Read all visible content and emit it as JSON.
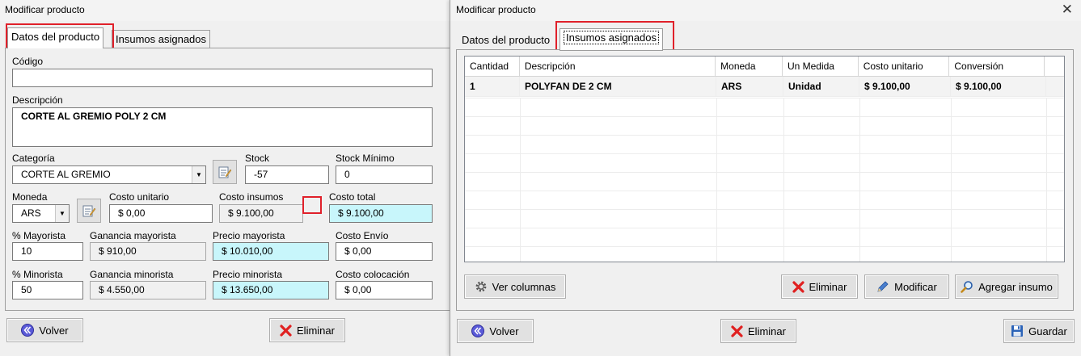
{
  "left": {
    "title": "Modificar producto",
    "tabs": [
      {
        "label": "Datos del producto"
      },
      {
        "label": "Insumos asignados"
      }
    ],
    "fields": {
      "codigo": {
        "label": "Código",
        "value": ""
      },
      "descripcion": {
        "label": "Descripción",
        "value": "CORTE AL GREMIO POLY 2 CM"
      },
      "categoria": {
        "label": "Categoría",
        "value": "CORTE AL GREMIO"
      },
      "stock": {
        "label": "Stock",
        "value": "-57"
      },
      "stock_minimo": {
        "label": "Stock Mínimo",
        "value": "0"
      },
      "moneda": {
        "label": "Moneda",
        "value": "ARS"
      },
      "costo_unitario": {
        "label": "Costo unitario",
        "value": "$ 0,00"
      },
      "costo_insumos": {
        "label": "Costo insumos",
        "value": "$ 9.100,00"
      },
      "costo_total": {
        "label": "Costo total",
        "value": "$ 9.100,00"
      },
      "pct_mayorista": {
        "label": "% Mayorista",
        "value": "10"
      },
      "ganancia_mayorista": {
        "label": "Ganancia mayorista",
        "value": "$ 910,00"
      },
      "precio_mayorista": {
        "label": "Precio mayorista",
        "value": "$ 10.010,00"
      },
      "costo_envio": {
        "label": "Costo Envío",
        "value": "$ 0,00"
      },
      "pct_minorista": {
        "label": "% Minorista",
        "value": "50"
      },
      "ganancia_minorista": {
        "label": "Ganancia minorista",
        "value": "$ 4.550,00"
      },
      "precio_minorista": {
        "label": "Precio minorista",
        "value": "$ 13.650,00"
      },
      "costo_colocacion": {
        "label": "Costo colocación",
        "value": "$ 0,00"
      }
    },
    "buttons": {
      "volver": "Volver",
      "eliminar": "Eliminar"
    }
  },
  "right": {
    "title": "Modificar producto",
    "close_glyph": "✕",
    "tabs": [
      {
        "label": "Datos del producto"
      },
      {
        "label": "Insumos asignados"
      }
    ],
    "table": {
      "headers": [
        "Cantidad",
        "Descripción",
        "Moneda",
        "Un Medida",
        "Costo unitario",
        "Conversión"
      ],
      "rows": [
        [
          "1",
          "POLYFAN  DE 2 CM",
          "ARS",
          "Unidad",
          "$ 9.100,00",
          "$ 9.100,00"
        ]
      ]
    },
    "buttons": {
      "ver_columnas": "Ver columnas",
      "eliminar": "Eliminar",
      "modificar": "Modificar",
      "agregar_insumo": "Agregar insumo",
      "volver": "Volver",
      "eliminar_bottom": "Eliminar",
      "guardar": "Guardar"
    }
  },
  "colors": {
    "highlight_red": "#e0202a",
    "cyan_field": "#c8f6fb",
    "volver_icon": "#5a5ad8",
    "eliminar_icon": "#e02020"
  },
  "icons": [
    "edit-list-icon",
    "back-arrows-icon",
    "red-x-icon",
    "gear-icon",
    "pencil-icon",
    "magnifier-icon",
    "floppy-disk-icon",
    "dropdown-arrow-icon",
    "close-icon"
  ]
}
